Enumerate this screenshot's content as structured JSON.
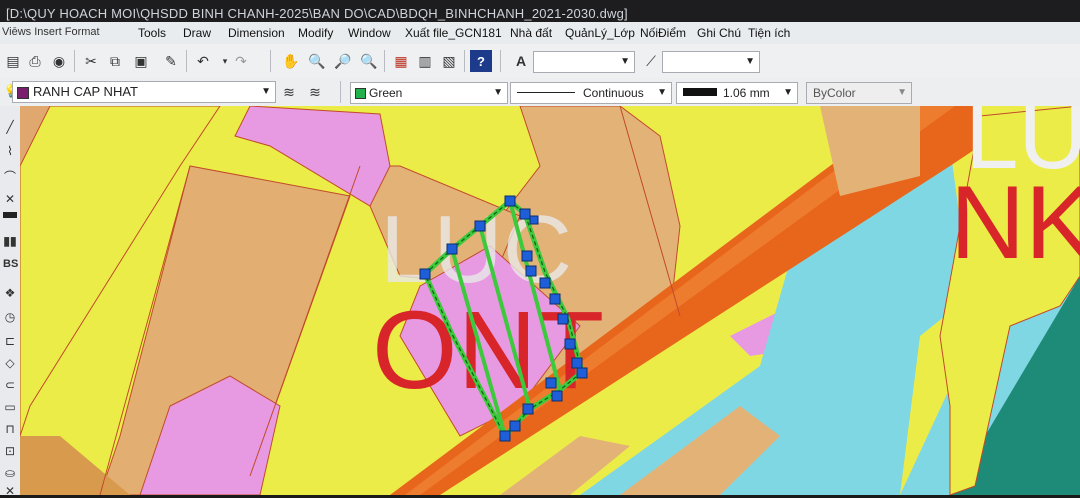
{
  "window": {
    "title": "[D:\\QUY HOACH MOI\\QHSDD BINH CHANH-2025\\BAN DO\\CAD\\BDQH_BINHCHANH_2021-2030.dwg]"
  },
  "menu": [
    "Tools",
    "Draw",
    "Dimension",
    "Modify",
    "Window",
    "Xuất file_GCN181",
    "Nhà đất",
    "QuảnLý_Lớp",
    "NốiĐiểm",
    "Ghi Chú",
    "Tiện ích"
  ],
  "menu_partial": "Viēws  Insert  Format",
  "layer": {
    "name": "RANH CAP NHAT",
    "color": "#7a1f6e"
  },
  "color_combo": {
    "label": "Green",
    "swatch": "#22b14c"
  },
  "linetype_combo": {
    "label": "Continuous"
  },
  "lineweight_combo": {
    "label": "1.06 mm"
  },
  "plotstyle_combo": {
    "label": "ByColor"
  },
  "map_labels": {
    "luc_center": "LUC",
    "ont": "ONT",
    "luc_right": "LUC",
    "nk_right": "NK"
  },
  "colors": {
    "yellow": "#ecec48",
    "orange_band": "#e8661c",
    "tan": "#e2b071",
    "pink": "#e79ae2",
    "cyan": "#7fd7e3",
    "teal": "#1e8a78",
    "red_text": "#d8252a",
    "selection": "#3cc93c",
    "grip": "#1e5fd9"
  }
}
